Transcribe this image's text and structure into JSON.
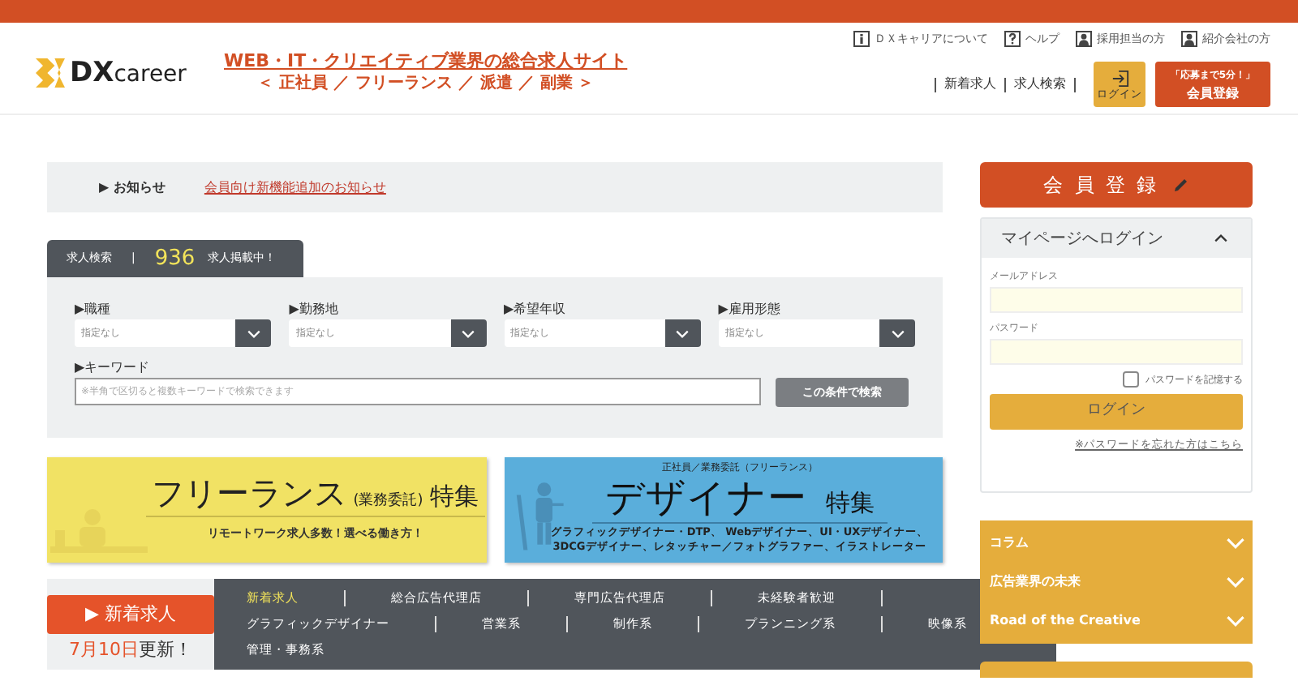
{
  "header": {
    "logo": {
      "mark": "DX",
      "word": "career"
    },
    "tagline": {
      "line1": "WEB・IT・クリエイティブ業界の総合求人サイト",
      "line2": "＜ 正社員 ／ フリーランス ／ 派遣 ／ 副業 ＞"
    },
    "top_links": [
      {
        "kind": "info",
        "label": "ＤＸキャリアについて"
      },
      {
        "kind": "help",
        "label": "ヘルプ"
      },
      {
        "kind": "person",
        "label": "採用担当の方"
      },
      {
        "kind": "person",
        "label": "紹介会社の方"
      }
    ],
    "nav_links": [
      "新着求人",
      "求人検索"
    ],
    "login_button": "ログイン",
    "register_button": {
      "line1": "「応募まで5分！」",
      "line2": "会員登録"
    }
  },
  "notice": {
    "heading": "▶ お知らせ",
    "link": "会員向け新機能追加のお知らせ"
  },
  "search": {
    "tab_label": "求人検索",
    "separator": "|",
    "count": "936",
    "count_suffix": "求人掲載中！",
    "filters": [
      {
        "label": "▶職種",
        "value": "指定なし"
      },
      {
        "label": "▶勤務地",
        "value": "指定なし"
      },
      {
        "label": "▶希望年収",
        "value": "指定なし"
      },
      {
        "label": "▶雇用形態",
        "value": "指定なし"
      }
    ],
    "keyword_label": "▶キーワード",
    "keyword_placeholder": "※半角で区切ると複数キーワードで検索できます",
    "submit": "この条件で検索"
  },
  "banners": [
    {
      "kind": "freelance",
      "title": "フリーランス",
      "title_note": "(業務委託)",
      "title_suffix": "特集",
      "subtitle": "リモートワーク求人多数！選べる働き方！"
    },
    {
      "kind": "designer",
      "eyebrow": "正社員／業務委託（フリーランス）",
      "title": "デザイナー",
      "title_suffix": "特集",
      "subtitle_lines": [
        "グラフィックデザイナー・DTP、 Webデザイナー、UI・UXデザイナー、",
        "3DCGデザイナー、レタッチャー／フォトグラファー、イラストレーター"
      ]
    }
  ],
  "new_jobs": {
    "button": "▶ 新着求人",
    "updated_date": "7月10日",
    "updated_suffix": "更新！",
    "category_rows": [
      {
        "items": [
          {
            "label": "新着求人",
            "selected": true
          },
          {
            "label": "総合広告代理店",
            "selected": false
          },
          {
            "label": "専門広告代理店",
            "selected": false
          },
          {
            "label": "未経験者歓迎",
            "selected": false
          }
        ]
      },
      {
        "items": [
          {
            "label": "グラフィックデザイナー",
            "selected": false
          },
          {
            "label": "営業系",
            "selected": false
          },
          {
            "label": "制作系",
            "selected": false
          },
          {
            "label": "プランニング系",
            "selected": false
          },
          {
            "label": "映像系",
            "selected": false
          }
        ]
      },
      {
        "items": [
          {
            "label": "管理・事務系",
            "selected": false
          }
        ]
      }
    ]
  },
  "sidebar": {
    "register_button": "会員登録",
    "login": {
      "title": "マイページへログイン",
      "expanded": true,
      "email_label": "メールアドレス",
      "password_label": "パスワード",
      "remember": {
        "label": "パスワードを記憶する",
        "checked": false
      },
      "submit": "ログイン",
      "forgot_link": "※パスワードを忘れた方はこちら"
    },
    "accordion": [
      {
        "label": "コラム",
        "expanded": false
      },
      {
        "label": "広告業界の未来",
        "expanded": false
      },
      {
        "label": "Road of the Creative",
        "expanded": false
      }
    ]
  }
}
